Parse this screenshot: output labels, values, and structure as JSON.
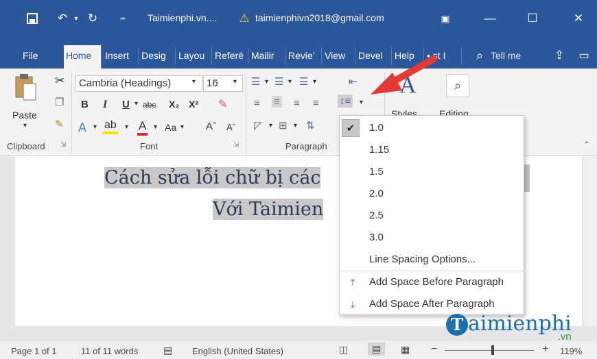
{
  "titlebar": {
    "doc_title": "Taimienphi.vn....",
    "account": "taimienphivn2018@gmail.com"
  },
  "tabs": [
    "File",
    "Home",
    "Insert",
    "Desig",
    "Layou",
    "Referē",
    "Mailir",
    "Revie’",
    "View",
    "Devel",
    "Help",
    "• st I"
  ],
  "tell_me": "Tell me",
  "ribbon": {
    "paste_label": "Paste",
    "font_name": "Cambria (Headings)",
    "font_size": "16",
    "bold": "B",
    "italic": "I",
    "underline": "U",
    "strike": "abc",
    "subscript": "X₂",
    "superscript": "X²",
    "aa": "Aa",
    "grow": "Aˆ",
    "shrink": "Aˇ",
    "styles_label": "Styles",
    "editing_label": "Editing",
    "groups": {
      "clipboard": "Clipboard",
      "font": "Font",
      "paragraph": "Paragraph"
    }
  },
  "document": {
    "line1": "Cách sửa lỗi chữ bị các",
    "line2": "Với Taimien"
  },
  "line_spacing_menu": {
    "items": [
      "1.0",
      "1.15",
      "1.5",
      "2.0",
      "2.5",
      "3.0"
    ],
    "checked": "1.0",
    "options": "Line Spacing Options...",
    "add_before": "Add Space Before Paragraph",
    "add_after": "Add Space After Paragraph"
  },
  "status": {
    "page": "Page 1 of 1",
    "words": "11 of 11 words",
    "language": "English (United States)",
    "zoom": "119%"
  },
  "watermark": {
    "brand": "aimienphi",
    "tld": ".vn"
  },
  "colors": {
    "word_blue": "#2b579a",
    "arrow_red": "#e53935",
    "highlight_gray": "#c9c9c9"
  }
}
